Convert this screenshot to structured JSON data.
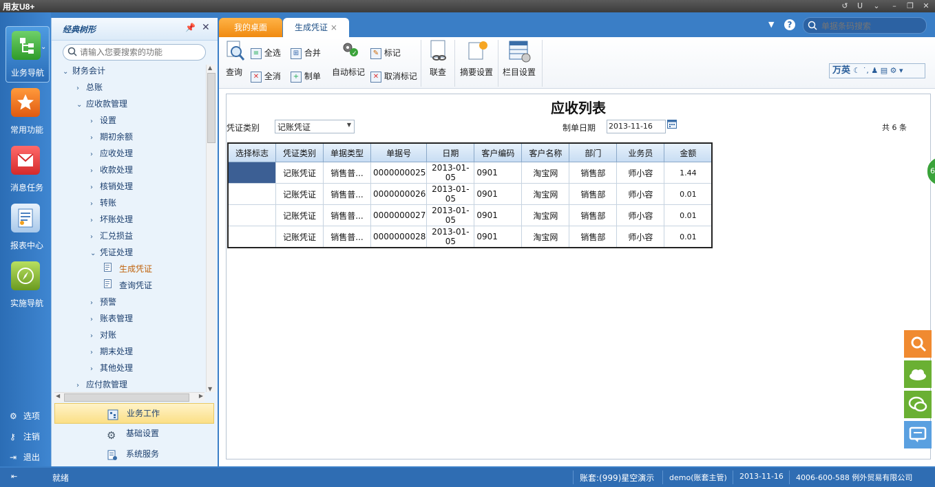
{
  "app": {
    "logo": "用友U8+"
  },
  "rail": {
    "items": [
      {
        "label": "业务导航"
      },
      {
        "label": "常用功能"
      },
      {
        "label": "消息任务"
      },
      {
        "label": "报表中心"
      },
      {
        "label": "实施导航"
      }
    ],
    "links": [
      {
        "label": "选项"
      },
      {
        "label": "注销"
      },
      {
        "label": "退出"
      }
    ]
  },
  "tree": {
    "title": "经典树形",
    "search_placeholder": "请输入您要搜索的功能",
    "items": [
      {
        "label": "财务会计",
        "arrow": "⌄"
      },
      {
        "label": "总账",
        "arrow": "›"
      },
      {
        "label": "应收款管理",
        "arrow": "⌄"
      },
      {
        "label": "设置",
        "arrow": "›"
      },
      {
        "label": "期初余额",
        "arrow": "›"
      },
      {
        "label": "应收处理",
        "arrow": "›"
      },
      {
        "label": "收款处理",
        "arrow": "›"
      },
      {
        "label": "核销处理",
        "arrow": "›"
      },
      {
        "label": "转账",
        "arrow": "›"
      },
      {
        "label": "坏账处理",
        "arrow": "›"
      },
      {
        "label": "汇兑损益",
        "arrow": "›"
      },
      {
        "label": "凭证处理",
        "arrow": "⌄"
      },
      {
        "label": "生成凭证",
        "arrow": ""
      },
      {
        "label": "查询凭证",
        "arrow": ""
      },
      {
        "label": "预警",
        "arrow": "›"
      },
      {
        "label": "账表管理",
        "arrow": "›"
      },
      {
        "label": "对账",
        "arrow": "›"
      },
      {
        "label": "期末处理",
        "arrow": "›"
      },
      {
        "label": "其他处理",
        "arrow": "›"
      },
      {
        "label": "应付款管理",
        "arrow": "›"
      }
    ],
    "bottom": [
      {
        "label": "业务工作"
      },
      {
        "label": "基础设置"
      },
      {
        "label": "系统服务"
      }
    ]
  },
  "tabs": [
    {
      "label": "我的桌面"
    },
    {
      "label": "生成凭证",
      "close": "×"
    }
  ],
  "global_search_placeholder": "单据条码搜索",
  "toolbar": {
    "query": "查询",
    "select_all": "全选",
    "deselect_all": "全消",
    "merge": "合并",
    "make_voucher": "制单",
    "auto_mark": "自动标记",
    "mark": "标记",
    "cancel_mark": "取消标记",
    "linked_query": "联查",
    "summary_settings": "摘要设置",
    "column_settings": "栏目设置"
  },
  "ime": {
    "label": "万英"
  },
  "form": {
    "title": "应收列表",
    "voucher_type_label": "凭证类别",
    "voucher_type_value": "记账凭证",
    "date_label": "制单日期",
    "date_value": "2013-11-16",
    "count": "共 6 条"
  },
  "table": {
    "headers": [
      "选择标志",
      "凭证类别",
      "单据类型",
      "单据号",
      "日期",
      "客户编码",
      "客户名称",
      "部门",
      "业务员",
      "金额"
    ],
    "rows": [
      [
        "",
        "记账凭证",
        "销售普...",
        "0000000025",
        "2013-01-05",
        "0901",
        "淘宝网",
        "销售部",
        "师小容",
        "1.44"
      ],
      [
        "",
        "记账凭证",
        "销售普...",
        "0000000026",
        "2013-01-05",
        "0901",
        "淘宝网",
        "销售部",
        "师小容",
        "0.01"
      ],
      [
        "",
        "记账凭证",
        "销售普...",
        "0000000027",
        "2013-01-05",
        "0901",
        "淘宝网",
        "销售部",
        "师小容",
        "0.01"
      ],
      [
        "",
        "记账凭证",
        "销售普...",
        "0000000028",
        "2013-01-05",
        "0901",
        "淘宝网",
        "销售部",
        "师小容",
        "0.01"
      ]
    ]
  },
  "edge_badge": "6",
  "status": {
    "ready": "就绪",
    "account": "账套:(999)星空演示",
    "user": "demo(账套主管)",
    "date": "2013-11-16",
    "company": "4006-600-588 例外贸易有限公司"
  },
  "colors": {
    "accent_orange": "#f08a10",
    "brand_blue": "#3a7ec6",
    "selected_cell": "#3c5f94"
  }
}
